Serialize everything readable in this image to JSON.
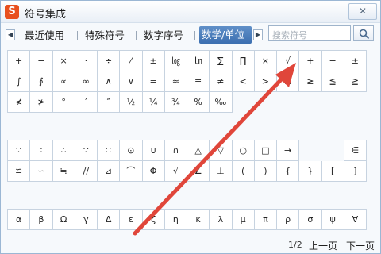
{
  "window": {
    "title": "符号集成",
    "logo_text": "S",
    "close_glyph": "✕"
  },
  "tabs": {
    "items": [
      {
        "label": "最近使用"
      },
      {
        "label": "特殊符号"
      },
      {
        "label": "数字序号"
      },
      {
        "label": "数学/单位"
      }
    ],
    "active_index": 3
  },
  "search": {
    "placeholder": "搜索符号"
  },
  "grid_a": [
    "+",
    "−",
    "×",
    "·",
    "÷",
    "⁄",
    "±",
    "㏒",
    "㏑",
    "∑",
    "∏",
    "×",
    "√",
    "+",
    "−",
    "±",
    "∫",
    "∮",
    "∝",
    "∞",
    "∧",
    "∨",
    "=",
    "≈",
    "≡",
    "≠",
    "<",
    ">",
    "≤",
    "≥",
    "≦",
    "≧",
    "≮",
    "≯",
    "°",
    "′",
    "″",
    "½",
    "¼",
    "¾",
    "%",
    "‰",
    "",
    "",
    "",
    "",
    "",
    ""
  ],
  "grid_b": [
    "∵",
    "∶",
    "∴",
    "∵",
    "∷",
    "⊙",
    "∪",
    "∩",
    "△",
    "▽",
    "○",
    "□",
    "→",
    "",
    "",
    "∈",
    "≌",
    "∽",
    "≒",
    "//",
    "⊿",
    "⌒",
    "Φ",
    "√",
    "∠",
    "⊥",
    "(",
    ")",
    "{",
    "}",
    "[",
    "]"
  ],
  "grid_c": [
    "α",
    "β",
    "Ω",
    "γ",
    "Δ",
    "ε",
    "ζ",
    "η",
    "κ",
    "λ",
    "μ",
    "π",
    "ρ",
    "σ",
    "ψ",
    "∀"
  ],
  "status": {
    "page": "1/2",
    "prev_label": "上一页",
    "next_label": "下一页"
  },
  "colors": {
    "accent": "#3c6fb0",
    "annotation_arrow": "#e0463a",
    "logo": "#e8501e"
  }
}
